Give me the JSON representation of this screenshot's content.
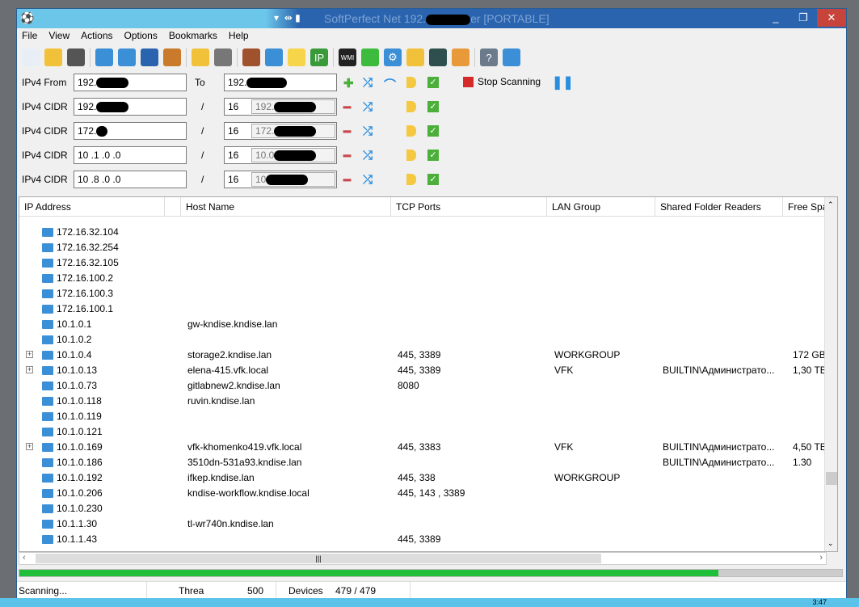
{
  "window": {
    "title_prefix": "SoftPerfect Net",
    "title_ip": "192.",
    "title_suffix": "er [PORTABLE]",
    "minimize": "_",
    "restore": "❐",
    "close": "✕"
  },
  "menu": [
    "File",
    "View",
    "Actions",
    "Options",
    "Bookmarks",
    "Help"
  ],
  "toolbar": [
    {
      "icon": "new-icon",
      "color": "#e8eef5"
    },
    {
      "icon": "open-folder-icon",
      "color": "#f2c13a"
    },
    {
      "icon": "save-icon",
      "color": "#555"
    },
    {
      "icon": "remove-node-icon",
      "color": "#3a8fd6"
    },
    {
      "icon": "add-node-icon",
      "color": "#3a8fd6"
    },
    {
      "icon": "binoculars-icon",
      "color": "#2a64ae"
    },
    {
      "icon": "clipboard-icon",
      "color": "#c97a2a"
    },
    {
      "icon": "filter-folder-icon",
      "color": "#f2c13a"
    },
    {
      "icon": "filter-icon",
      "color": "#777"
    },
    {
      "icon": "tools-icon",
      "color": "#a0522d"
    },
    {
      "icon": "computer-icon",
      "color": "#3a8fd6"
    },
    {
      "icon": "lightbulb-icon",
      "color": "#f7d54a"
    },
    {
      "icon": "ip-card-icon",
      "color": "#3a9a3a",
      "text": "IP"
    },
    {
      "icon": "wmi-icon",
      "color": "#222",
      "text": "WMI"
    },
    {
      "icon": "registry-icon",
      "color": "#3dbb3d"
    },
    {
      "icon": "gear-icon",
      "color": "#3a8fd6",
      "text": "⚙"
    },
    {
      "icon": "shared-folder-icon",
      "color": "#f2c13a"
    },
    {
      "icon": "monitor-icon",
      "color": "#2f4f4f"
    },
    {
      "icon": "users-icon",
      "color": "#e89a3a"
    },
    {
      "icon": "help-icon",
      "color": "#6b7b8c",
      "text": "?"
    },
    {
      "icon": "globe-icon",
      "color": "#3a8fd6"
    }
  ],
  "ranges": [
    {
      "label": "IPv4 From",
      "start": "192.",
      "sep": "To",
      "end": "192.",
      "mask": ""
    },
    {
      "label": "IPv4 CIDR",
      "start": "192.",
      "sep": "/",
      "end": "16",
      "mask": "192."
    },
    {
      "label": "IPv4 CIDR",
      "start": "172.",
      "sep": "/",
      "end": "16",
      "mask": "172."
    },
    {
      "label": "IPv4 CIDR",
      "start": "10 .1  .0  .0",
      "sep": "/",
      "end": "16",
      "mask": "10.0"
    },
    {
      "label": "IPv4 CIDR",
      "start": "10 .8  .0  .0",
      "sep": "/",
      "end": "16",
      "mask": "10"
    }
  ],
  "stop_scanning": "Stop Scanning",
  "columns": [
    "IP Address",
    "",
    "Host Name",
    "TCP Ports",
    "LAN Group",
    "Shared Folder Readers",
    "Free Spa"
  ],
  "rows": [
    {
      "ip": "172.16.32.104",
      "host": "",
      "ports": "",
      "group": "",
      "readers": "",
      "free": ""
    },
    {
      "ip": "172.16.32.254",
      "host": "",
      "ports": "",
      "group": "",
      "readers": "",
      "free": ""
    },
    {
      "ip": "172.16.32.105",
      "host": "",
      "ports": "",
      "group": "",
      "readers": "",
      "free": ""
    },
    {
      "ip": "172.16.100.2",
      "host": "",
      "ports": "",
      "group": "",
      "readers": "",
      "free": ""
    },
    {
      "ip": "172.16.100.3",
      "host": "",
      "ports": "",
      "group": "",
      "readers": "",
      "free": ""
    },
    {
      "ip": "172.16.100.1",
      "host": "",
      "ports": "",
      "group": "",
      "readers": "",
      "free": ""
    },
    {
      "ip": "10.1.0.1",
      "host": "gw-kndise.kndise.lan",
      "ports": "",
      "group": "",
      "readers": "",
      "free": ""
    },
    {
      "ip": "10.1.0.2",
      "host": "",
      "ports": "",
      "group": "",
      "readers": "",
      "free": ""
    },
    {
      "ip": "10.1.0.4",
      "expand": true,
      "host": "storage2.kndise.lan",
      "ports": "445, 3389",
      "group": "WORKGROUP",
      "readers": "",
      "free": "172 GB"
    },
    {
      "ip": "10.1.0.13",
      "expand": true,
      "host": "elena-415.vfk.local",
      "ports": "445, 3389",
      "group": "VFK",
      "readers": "BUILTIN\\Администрато...",
      "free": "1,30 TB"
    },
    {
      "ip": "10.1.0.73",
      "host": "gitlabnew2.kndise.lan",
      "ports": "8080",
      "group": "",
      "readers": "",
      "free": ""
    },
    {
      "ip": "10.1.0.118",
      "host": "ruvin.kndise.lan",
      "ports": "",
      "group": "",
      "readers": "",
      "free": ""
    },
    {
      "ip": "10.1.0.119",
      "host": "",
      "ports": "",
      "group": "",
      "readers": "",
      "free": ""
    },
    {
      "ip": "10.1.0.121",
      "host": "",
      "ports": "",
      "group": "",
      "readers": "",
      "free": ""
    },
    {
      "ip": "10.1.0.169",
      "expand": true,
      "host": "vfk-khomenko419.vfk.local",
      "ports": "445, 3383",
      "group": "VFK",
      "readers": "BUILTIN\\Администрато...",
      "free": "4,50 TB"
    },
    {
      "ip": "10.1.0.186",
      "host": "3510dn-531a93.kndise.lan",
      "ports": "",
      "group": "",
      "readers": "BUILTIN\\Администрато...",
      "free": "1.30"
    },
    {
      "ip": "10.1.0.192",
      "host": "ifkep.kndise.lan",
      "ports": "445, 338",
      "group": "WORKGROUP",
      "readers": "",
      "free": ""
    },
    {
      "ip": "10.1.0.206",
      "host": "kndise-workflow.kndise.local",
      "ports": "445, 143 , 3389",
      "group": "",
      "readers": "",
      "free": ""
    },
    {
      "ip": "10.1.0.230",
      "host": "",
      "ports": "",
      "group": "",
      "readers": "",
      "free": ""
    },
    {
      "ip": "10.1.1.30",
      "host": "tl-wr740n.kndise.lan",
      "ports": "",
      "group": "",
      "readers": "",
      "free": ""
    },
    {
      "ip": "10.1.1.43",
      "host": "",
      "ports": "445, 3389",
      "group": "",
      "readers": "",
      "free": ""
    }
  ],
  "progress": 0.85,
  "status": {
    "state": "Scanning...",
    "threads_label": "Threa",
    "threads": "500",
    "devices_label": "Devices",
    "devices": "479 / 479"
  },
  "clock": "3:47"
}
